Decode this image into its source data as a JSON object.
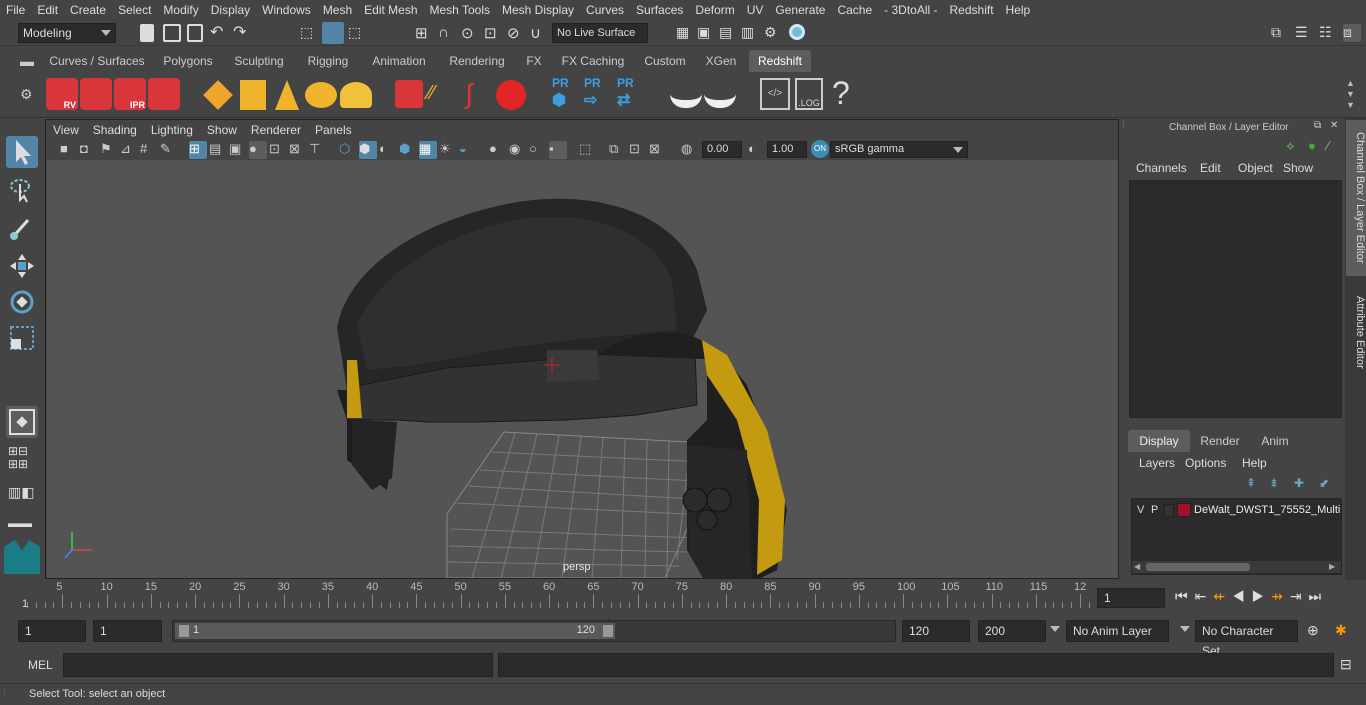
{
  "menu": [
    "File",
    "Edit",
    "Create",
    "Select",
    "Modify",
    "Display",
    "Windows",
    "Mesh",
    "Edit Mesh",
    "Mesh Tools",
    "Mesh Display",
    "Curves",
    "Surfaces",
    "Deform",
    "UV",
    "Generate",
    "Cache",
    "- 3DtoAll -",
    "Redshift",
    "Help"
  ],
  "status": {
    "mode": "Modeling",
    "live_surface": "No Live Surface"
  },
  "shelf_tabs": [
    "Curves / Surfaces",
    "Polygons",
    "Sculpting",
    "Rigging",
    "Animation",
    "Rendering",
    "FX",
    "FX Caching",
    "Custom",
    "XGen",
    "Redshift"
  ],
  "shelf_active": "Redshift",
  "shelf_icons": {
    "rv": "RV",
    "ipr": "IPR",
    "pr": "PR",
    "log": ".LOG",
    "help": "?"
  },
  "viewport": {
    "menu": [
      "View",
      "Shading",
      "Lighting",
      "Show",
      "Renderer",
      "Panels"
    ],
    "exposure": "0.00",
    "gamma": "1.00",
    "color_space": "sRGB gamma",
    "camera_label": "persp"
  },
  "channel_box": {
    "title": "Channel Box / Layer Editor",
    "menu": [
      "Channels",
      "Edit",
      "Object",
      "Show"
    ],
    "layer_tabs": [
      "Display",
      "Render",
      "Anim"
    ],
    "layer_menu": [
      "Layers",
      "Options",
      "Help"
    ],
    "layer": {
      "v": "V",
      "p": "P",
      "name": "DeWalt_DWST1_75552_Multi",
      "color": "#a0102a"
    }
  },
  "side_tabs": [
    "Channel Box / Layer Editor",
    "Attribute Editor"
  ],
  "timeline": {
    "ticks": [
      "5",
      "10",
      "15",
      "20",
      "25",
      "30",
      "35",
      "40",
      "45",
      "50",
      "55",
      "60",
      "65",
      "70",
      "75",
      "80",
      "85",
      "90",
      "95",
      "100",
      "105",
      "110",
      "115",
      "12"
    ],
    "start_marker": "1",
    "current_frame": "1"
  },
  "range": {
    "start": "1",
    "anim_start": "1",
    "slider_start": "1",
    "slider_end": "120",
    "end": "120",
    "anim_end": "200",
    "anim_layer": "No Anim Layer",
    "char_set": "No Character Set"
  },
  "mel": {
    "label": "MEL"
  },
  "help_line": "Select Tool: select an object"
}
